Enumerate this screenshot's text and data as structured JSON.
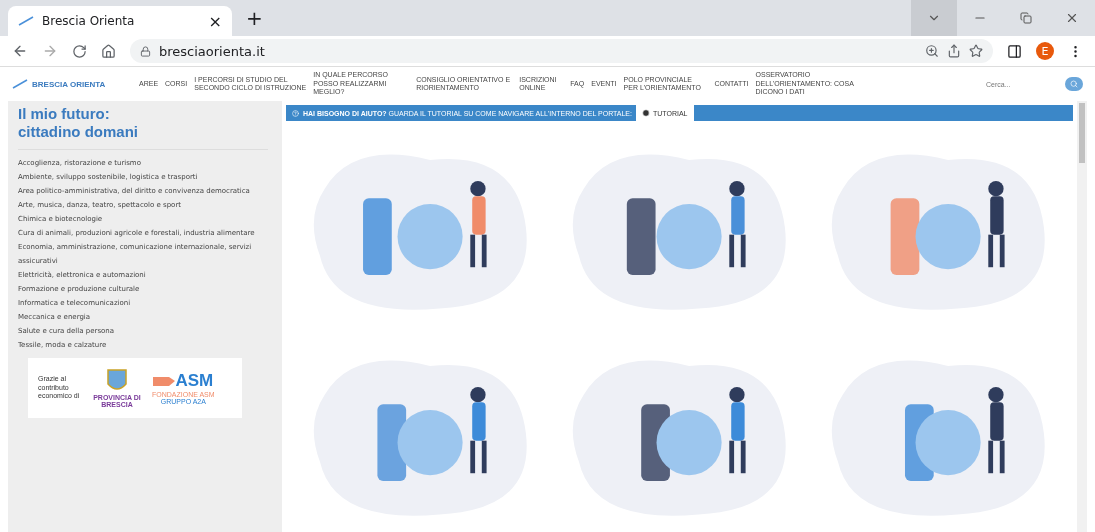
{
  "browser": {
    "tab_title": "Brescia Orienta",
    "tab_close": "×",
    "new_tab": "+",
    "url": "bresciaorienta.it",
    "profile": "E"
  },
  "site_nav": {
    "logo": "BRESCIA ORIENTA",
    "items": [
      {
        "label": "AREE"
      },
      {
        "label": "CORSI"
      },
      {
        "label": "I PERCORSI DI STUDIO DEL SECONDO CICLO DI ISTRUZIONE"
      },
      {
        "label": "IN QUALE PERCORSO POSSO REALIZZARMI MEGLIO?"
      },
      {
        "label": "CONSIGLIO ORIENTATIVO E RIORIENTAMENTO"
      },
      {
        "label": "ISCRIZIONI ONLINE"
      },
      {
        "label": "FAQ"
      },
      {
        "label": "EVENTI"
      },
      {
        "label": "POLO PROVINCIALE PER L'ORIENTAMENTO"
      },
      {
        "label": "CONTATTI"
      },
      {
        "label": "OSSERVATORIO DELL'ORIENTAMENTO: COSA DICONO I DATI"
      }
    ],
    "search": {
      "placeholder": "Cerca..."
    }
  },
  "sidebar": {
    "title": "Il mio futuro: cittadino domani",
    "items": [
      "Accoglienza, ristorazione e turismo",
      "Ambiente, sviluppo sostenibile, logistica e trasporti",
      "Area politico-amministrativa, del diritto e convivenza democratica",
      "Arte, musica, danza, teatro, spettacolo e sport",
      "Chimica e biotecnologie",
      "Cura di animali, produzioni agricole e forestali, industria alimentare",
      "Economia, amministrazione, comunicazione internazionale, servizi assicurativi",
      "Elettricità, elettronica e automazioni",
      "Formazione e produzione culturale",
      "Informatica e telecomunicazioni",
      "Meccanica e energia",
      "Salute e cura della persona",
      "Tessile, moda e calzature"
    ],
    "sponsor": {
      "text": "Grazie al contributo economico di",
      "logo_1": "PROVINCIA DI BRESCIA",
      "logo_2": "ASM",
      "logo_2_caption": "FONDAZIONE ASM",
      "logo_2_subcaption": "GRUPPO A2A"
    }
  },
  "help_bar": {
    "text": "**HAI BISOGNO DI AIUTO?** GUARDA IL TUTORIAL SU COME NAVIGARE ALL'INTERNO DEL PORTALE:",
    "button": "TUTORIAL"
  }
}
